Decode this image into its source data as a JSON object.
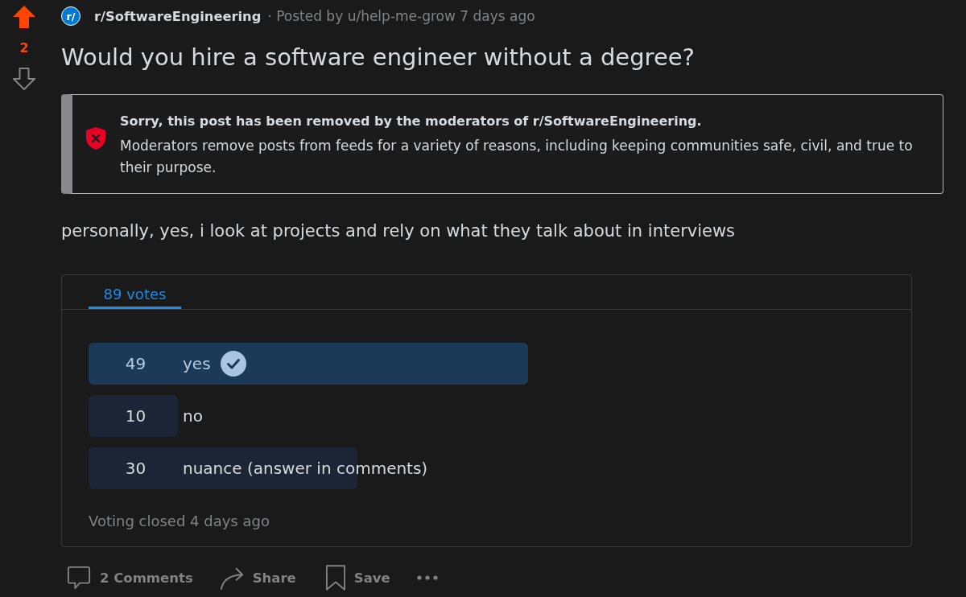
{
  "vote": {
    "upvoted": true,
    "downvoted": false,
    "score": "2"
  },
  "post": {
    "subreddit": "r/SoftwareEngineering",
    "avatar_text": "r/",
    "meta": "· Posted by u/help-me-grow 7 days ago",
    "title": "Would you hire a software engineer without a degree?",
    "removal_notice": {
      "heading": "Sorry, this post has been removed by the moderators of r/SoftwareEngineering.",
      "message": "Moderators remove posts from feeds for a variety of reasons, including keeping communities safe, civil, and true to their purpose."
    },
    "body": "personally, yes, i look at projects and rely on what they talk about in interviews"
  },
  "poll": {
    "tabs": [
      {
        "label": "89 votes",
        "selected": true
      }
    ],
    "options": [
      {
        "count": "49",
        "label": "yes",
        "level": 0.551,
        "leading": true,
        "selected": true
      },
      {
        "count": "10",
        "label": "no",
        "level": 0.112,
        "leading": false,
        "selected": false
      },
      {
        "count": "30",
        "label": "nuance (answer in comments)",
        "level": 0.337,
        "leading": false,
        "selected": false
      }
    ],
    "status": "Voting closed 4 days ago"
  },
  "actions": [
    {
      "kind": "comments",
      "label": "2 Comments"
    },
    {
      "kind": "share",
      "label": "Share"
    },
    {
      "kind": "save",
      "label": "Save"
    },
    {
      "kind": "more"
    }
  ]
}
